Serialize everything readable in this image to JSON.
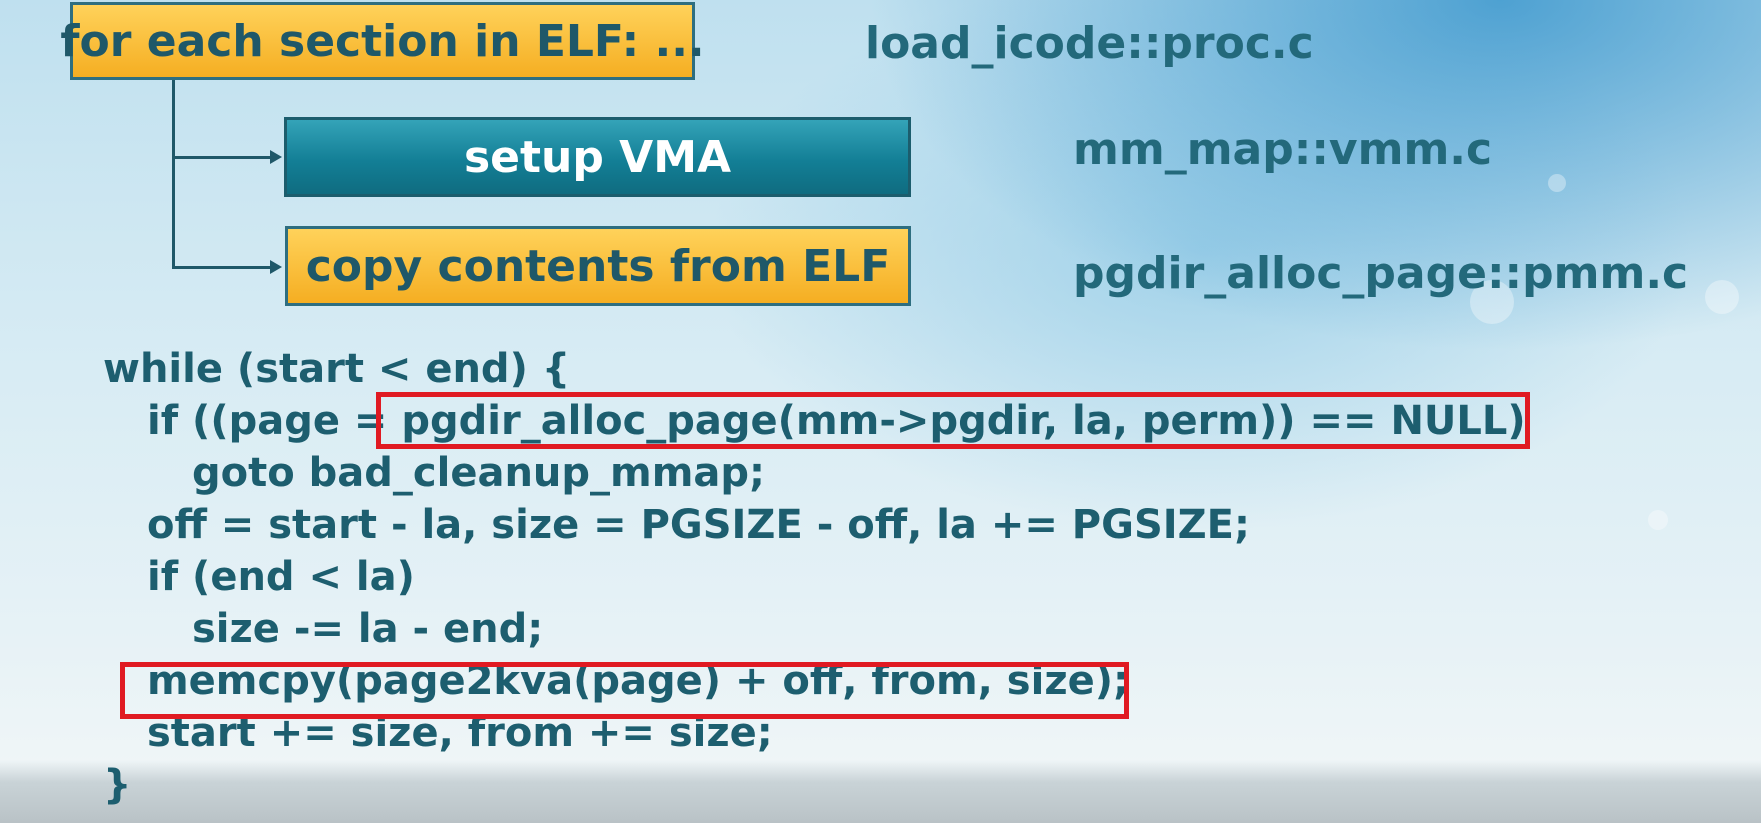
{
  "flow": {
    "loop_box": "for each section in ELF: ...",
    "step_setup": "setup VMA",
    "step_copy": "copy contents from ELF"
  },
  "files": {
    "load": "load_icode::proc.c",
    "mmap": "mm_map::vmm.c",
    "alloc": "pgdir_alloc_page::pmm.c"
  },
  "code": [
    "while (start < end) {",
    "if ((page = pgdir_alloc_page(mm->pgdir, la, perm)) == NULL)",
    "goto bad_cleanup_mmap;",
    "off = start - la, size = PGSIZE - off, la += PGSIZE;",
    "if (end < la)",
    "size -= la - end;",
    "memcpy(page2kva(page) + off, from, size);",
    "start += size, from += size;",
    "}"
  ],
  "colors": {
    "orange_box": "#f5ae22",
    "teal_box": "#137f96",
    "text_dark": "#1d5e6f",
    "highlight": "#e01a22"
  }
}
